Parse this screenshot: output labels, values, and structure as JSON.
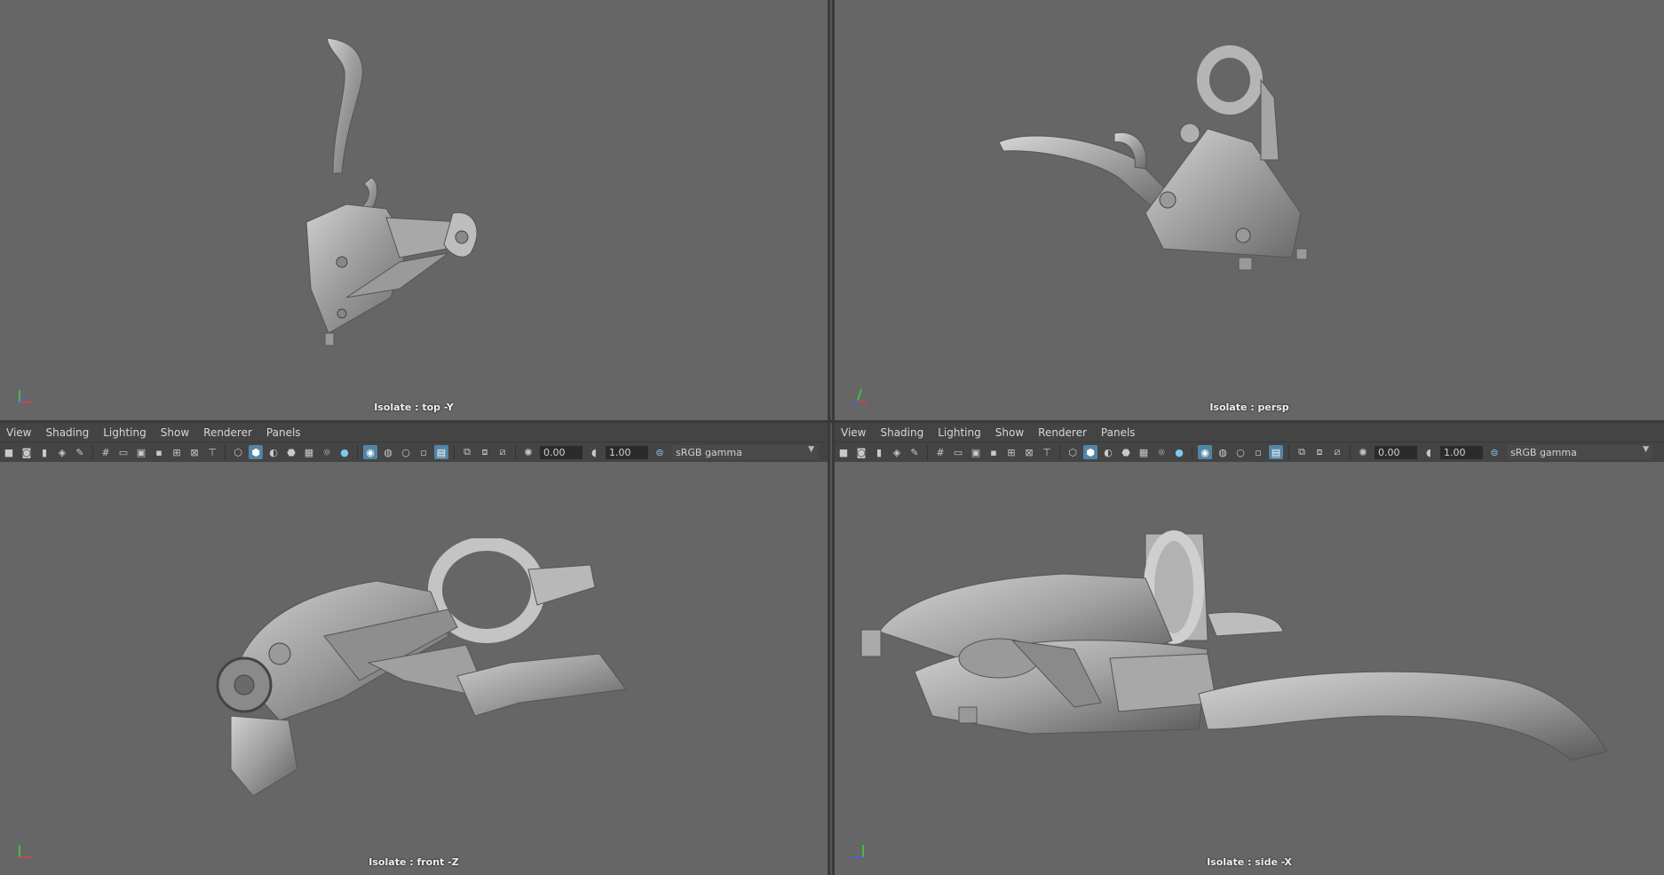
{
  "menus": [
    "View",
    "Shading",
    "Lighting",
    "Show",
    "Renderer",
    "Panels"
  ],
  "toolbar": {
    "exposure_value": "0.00",
    "gamma_value": "1.00",
    "color_space": "sRGB gamma"
  },
  "panes": {
    "top_left": {
      "caption": "Isolate : top -Y"
    },
    "top_right": {
      "caption": "Isolate : persp"
    },
    "bottom_left": {
      "caption": "Isolate : front -Z"
    },
    "bottom_right": {
      "caption": "Isolate : side -X"
    }
  },
  "colors": {
    "viewport_bg": "#666666",
    "toolbar_bg": "#444444",
    "active_icon": "#5285a6",
    "axis_x": "#e04040",
    "axis_y": "#40d040",
    "axis_z": "#4060ff"
  },
  "icons": [
    "camera-icon",
    "camera-attr-icon",
    "bookmark-icon",
    "image-plane-icon",
    "grid-icon",
    "film-gate-icon",
    "resolution-gate-icon",
    "wireframe-icon",
    "smooth-shade-icon",
    "textured-icon",
    "lights-icon",
    "shadows-icon",
    "ambient-occlusion-icon",
    "motion-blur-icon",
    "isolate-icon",
    "xray-icon",
    "exposure-icon",
    "gamma-icon",
    "color-management-icon"
  ]
}
